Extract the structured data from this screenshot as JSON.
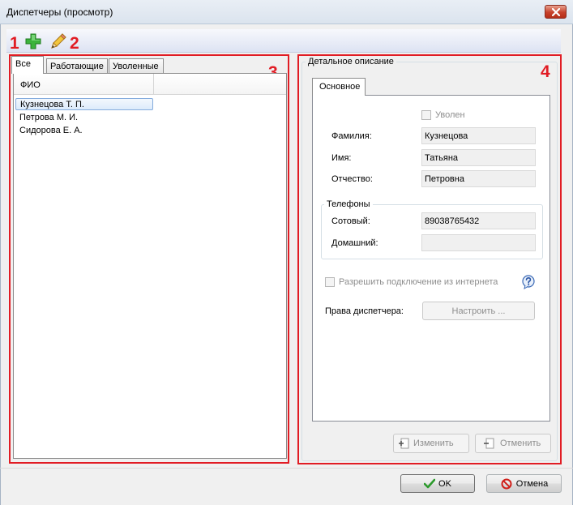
{
  "window": {
    "title": "Диспетчеры (просмотр)"
  },
  "toolbar": {
    "add_icon": "plus-icon",
    "edit_icon": "pencil-icon"
  },
  "annotations": [
    "1",
    "2",
    "3",
    "4"
  ],
  "list": {
    "tabs": [
      "Все",
      "Работающие",
      "Уволенные"
    ],
    "column_header": "ФИО",
    "rows": [
      "Кузнецова Т. П.",
      "Петрова М. И.",
      "Сидорова Е. А."
    ]
  },
  "details": {
    "group_title": "Детальное описание",
    "tab": "Основное",
    "fired_label": "Уволен",
    "surname_label": "Фамилия:",
    "surname_value": "Кузнецова",
    "name_label": "Имя:",
    "name_value": "Татьяна",
    "patronymic_label": "Отчество:",
    "patronymic_value": "Петровна",
    "phones_title": "Телефоны",
    "mobile_label": "Сотовый:",
    "mobile_value": "89038765432",
    "home_label": "Домашний:",
    "home_value": "",
    "internet_label": "Разрешить подключение из интернета",
    "rights_label": "Права диспетчера:",
    "configure_button": "Настроить ...",
    "change_button": "Изменить",
    "cancel_change_button": "Отменить"
  },
  "footer": {
    "ok_button": "OK",
    "cancel_button": "Отмена"
  },
  "colors": {
    "annotation_red": "#e11c24",
    "selection_blue": "#dcebfb"
  }
}
